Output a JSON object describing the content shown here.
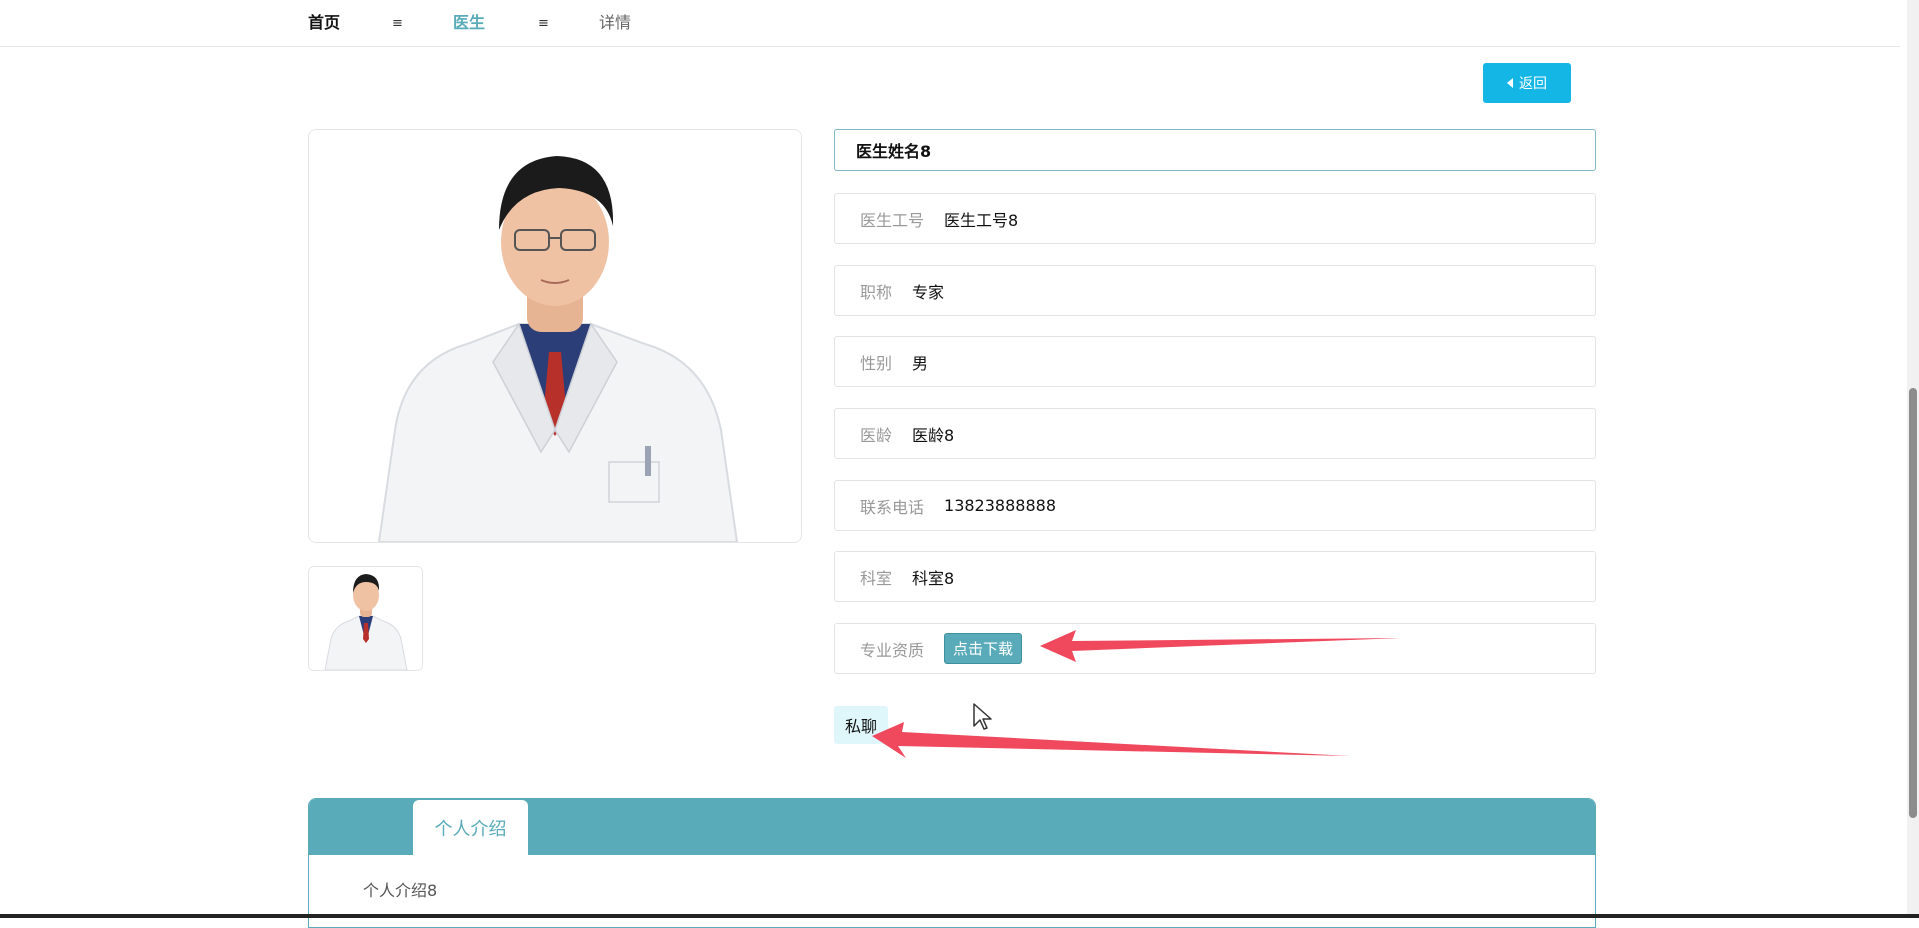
{
  "breadcrumb": {
    "home": "首页",
    "sep": "≡",
    "doctor": "医生",
    "detail": "详情"
  },
  "back_button": {
    "label": "返回"
  },
  "doctor": {
    "name": "医生姓名8",
    "fields": [
      {
        "label": "医生工号",
        "value": "医生工号8"
      },
      {
        "label": "职称",
        "value": "专家"
      },
      {
        "label": "性别",
        "value": "男"
      },
      {
        "label": "医龄",
        "value": "医龄8"
      },
      {
        "label": "联系电话",
        "value": "13823888888"
      },
      {
        "label": "科室",
        "value": "科室8"
      }
    ],
    "qualification": {
      "label": "专业资质",
      "button": "点击下载"
    }
  },
  "chat_button": {
    "label": "私聊"
  },
  "tabs": [
    {
      "label": "个人介绍",
      "active": true
    }
  ],
  "tab_content": "个人介绍8",
  "colors": {
    "accent": "#5aabb9",
    "back_button": "#13b6e4",
    "annotation_arrow": "#f0485d",
    "chat_bg": "#dff6fb"
  }
}
